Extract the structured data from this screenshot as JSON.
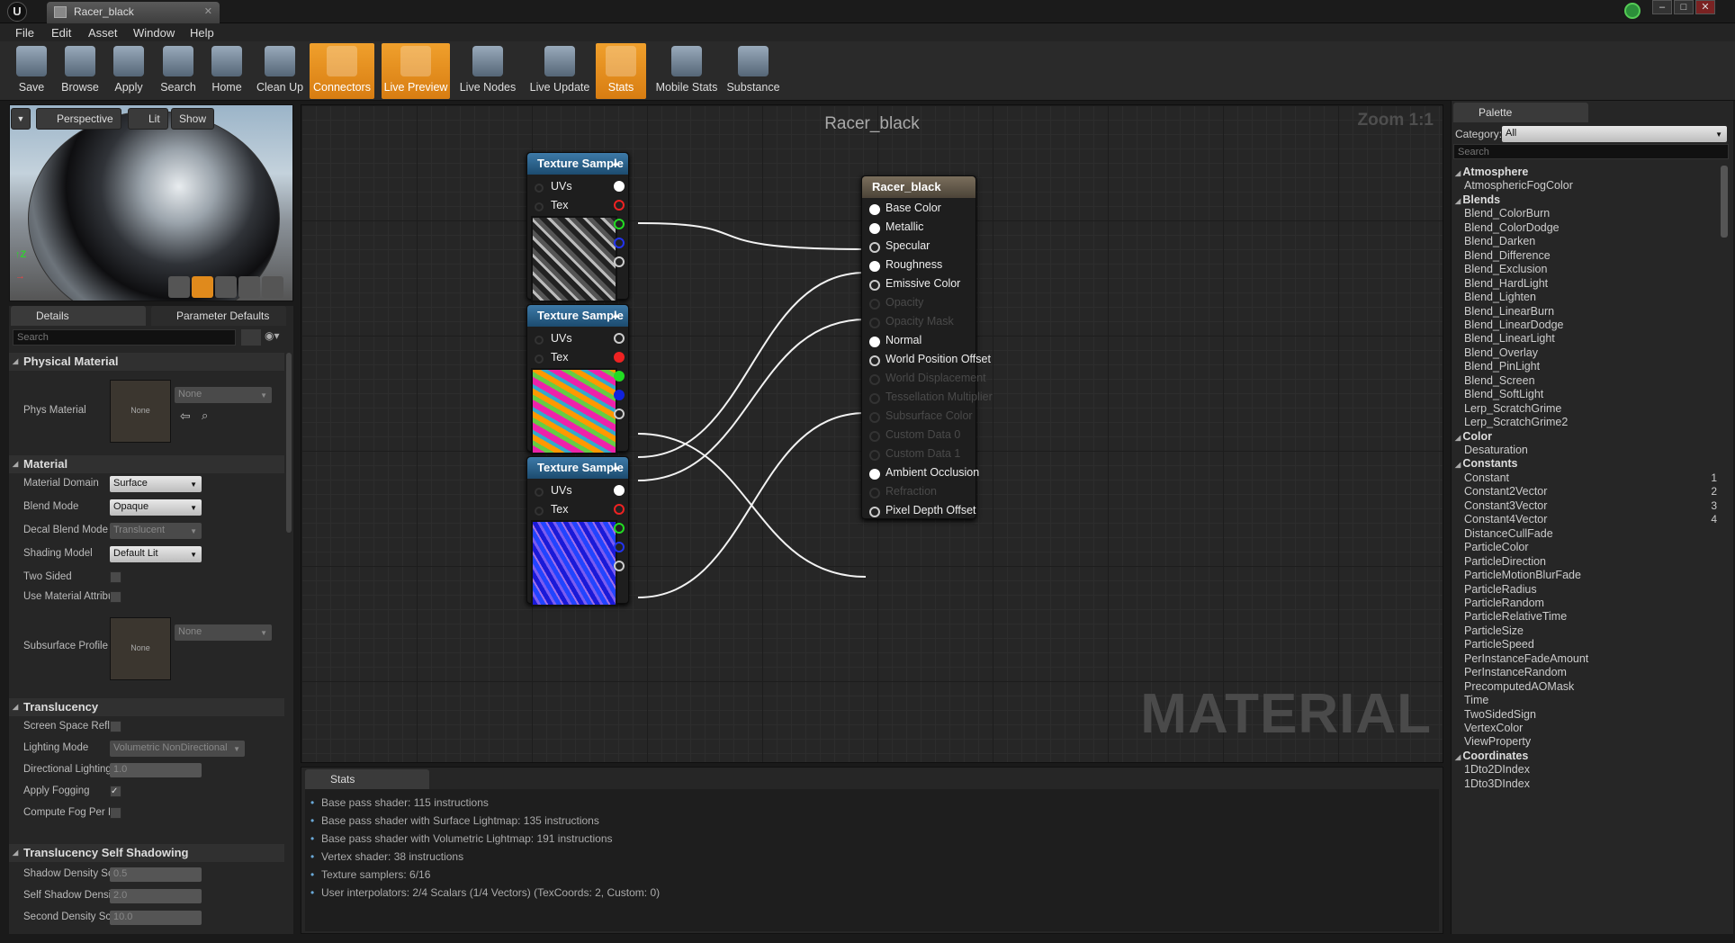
{
  "window": {
    "tab_title": "Racer_black"
  },
  "menu": [
    "File",
    "Edit",
    "Asset",
    "Window",
    "Help"
  ],
  "toolbar": [
    {
      "label": "Save",
      "icon": "save-icon",
      "active": false
    },
    {
      "label": "Browse",
      "icon": "browse-icon",
      "active": false
    },
    {
      "label": "Apply",
      "icon": "apply-icon",
      "active": false
    },
    {
      "label": "Search",
      "icon": "search-icon",
      "active": false
    },
    {
      "label": "Home",
      "icon": "home-icon",
      "active": false
    },
    {
      "label": "Clean Up",
      "icon": "clean-up-icon",
      "active": false
    },
    {
      "label": "Connectors",
      "icon": "connectors-icon",
      "active": true
    },
    {
      "label": "Live Preview",
      "icon": "live-preview-icon",
      "active": true
    },
    {
      "label": "Live Nodes",
      "icon": "live-nodes-icon",
      "active": false
    },
    {
      "label": "Live Update",
      "icon": "live-update-icon",
      "active": false
    },
    {
      "label": "Stats",
      "icon": "stats-icon",
      "active": true
    },
    {
      "label": "Mobile Stats",
      "icon": "mobile-stats-icon",
      "active": false
    },
    {
      "label": "Substance",
      "icon": "substance-icon",
      "active": false
    }
  ],
  "viewport": {
    "perspective": "Perspective",
    "lit": "Lit",
    "show": "Show"
  },
  "details": {
    "tab_details": "Details",
    "tab_params": "Parameter Defaults",
    "search_placeholder": "Search",
    "physical_material": {
      "title": "Physical Material",
      "phys_label": "Phys Material",
      "thumb": "None",
      "combo": "None"
    },
    "material": {
      "title": "Material",
      "rows": [
        {
          "label": "Material Domain",
          "value": "Surface"
        },
        {
          "label": "Blend Mode",
          "value": "Opaque"
        },
        {
          "label": "Decal Blend Mode",
          "value": "Translucent"
        },
        {
          "label": "Shading Model",
          "value": "Default Lit"
        },
        {
          "label": "Two Sided",
          "value": ""
        },
        {
          "label": "Use Material Attributes",
          "value": ""
        },
        {
          "label": "Subsurface Profile",
          "thumb": "None",
          "value": "None"
        }
      ]
    },
    "translucency": {
      "title": "Translucency",
      "rows": [
        {
          "label": "Screen Space Reflections",
          "value": ""
        },
        {
          "label": "Lighting Mode",
          "value": "Volumetric NonDirectional"
        },
        {
          "label": "Directional Lighting Intensity",
          "value": "1.0"
        },
        {
          "label": "Apply Fogging",
          "value": ""
        },
        {
          "label": "Compute Fog Per Pixel",
          "value": ""
        }
      ]
    },
    "self_shadow": {
      "title": "Translucency Self Shadowing",
      "rows": [
        {
          "label": "Shadow Density Scale",
          "value": "0.5"
        },
        {
          "label": "Self Shadow Density Scale",
          "value": "2.0"
        },
        {
          "label": "Second Density Scale",
          "value": "10.0"
        }
      ]
    }
  },
  "graph": {
    "title": "Racer_black",
    "zoom": "Zoom 1:1",
    "watermark": "MATERIAL",
    "sample_nodes": [
      {
        "title": "Texture Sample",
        "uvs": "UVs",
        "tex": "Tex"
      },
      {
        "title": "Texture Sample",
        "uvs": "UVs",
        "tex": "Tex"
      },
      {
        "title": "Texture Sample",
        "uvs": "UVs",
        "tex": "Tex"
      }
    ],
    "result_node": {
      "title": "Racer_black",
      "pins": [
        {
          "label": "Base Color",
          "state": "on"
        },
        {
          "label": "Metallic",
          "state": "on"
        },
        {
          "label": "Specular",
          "state": "open"
        },
        {
          "label": "Roughness",
          "state": "on"
        },
        {
          "label": "Emissive Color",
          "state": "open"
        },
        {
          "label": "Opacity",
          "state": "dim"
        },
        {
          "label": "Opacity Mask",
          "state": "dim"
        },
        {
          "label": "Normal",
          "state": "on"
        },
        {
          "label": "World Position Offset",
          "state": "open"
        },
        {
          "label": "World Displacement",
          "state": "dim"
        },
        {
          "label": "Tessellation Multiplier",
          "state": "dim"
        },
        {
          "label": "Subsurface Color",
          "state": "dim"
        },
        {
          "label": "Custom Data 0",
          "state": "dim"
        },
        {
          "label": "Custom Data 1",
          "state": "dim"
        },
        {
          "label": "Ambient Occlusion",
          "state": "on"
        },
        {
          "label": "Refraction",
          "state": "dim"
        },
        {
          "label": "Pixel Depth Offset",
          "state": "open"
        }
      ]
    }
  },
  "stats": {
    "tab": "Stats",
    "lines": [
      "Base pass shader: 115 instructions",
      "Base pass shader with Surface Lightmap: 135 instructions",
      "Base pass shader with Volumetric Lightmap: 191 instructions",
      "Vertex shader: 38 instructions",
      "Texture samplers: 6/16",
      "User interpolators: 2/4 Scalars (1/4 Vectors) (TexCoords: 2, Custom: 0)"
    ]
  },
  "palette": {
    "tab": "Palette",
    "category_label": "Category:",
    "category_value": "All",
    "search_placeholder": "Search",
    "entries": [
      {
        "type": "cat",
        "text": "Atmosphere"
      },
      {
        "type": "item",
        "text": "AtmosphericFogColor"
      },
      {
        "type": "cat",
        "text": "Blends"
      },
      {
        "type": "item",
        "text": "Blend_ColorBurn"
      },
      {
        "type": "item",
        "text": "Blend_ColorDodge"
      },
      {
        "type": "item",
        "text": "Blend_Darken"
      },
      {
        "type": "item",
        "text": "Blend_Difference"
      },
      {
        "type": "item",
        "text": "Blend_Exclusion"
      },
      {
        "type": "item",
        "text": "Blend_HardLight"
      },
      {
        "type": "item",
        "text": "Blend_Lighten"
      },
      {
        "type": "item",
        "text": "Blend_LinearBurn"
      },
      {
        "type": "item",
        "text": "Blend_LinearDodge"
      },
      {
        "type": "item",
        "text": "Blend_LinearLight"
      },
      {
        "type": "item",
        "text": "Blend_Overlay"
      },
      {
        "type": "item",
        "text": "Blend_PinLight"
      },
      {
        "type": "item",
        "text": "Blend_Screen"
      },
      {
        "type": "item",
        "text": "Blend_SoftLight"
      },
      {
        "type": "item",
        "text": "Lerp_ScratchGrime"
      },
      {
        "type": "item",
        "text": "Lerp_ScratchGrime2"
      },
      {
        "type": "cat",
        "text": "Color"
      },
      {
        "type": "item",
        "text": "Desaturation"
      },
      {
        "type": "cat",
        "text": "Constants"
      },
      {
        "type": "item",
        "text": "Constant",
        "hot": "1"
      },
      {
        "type": "item",
        "text": "Constant2Vector",
        "hot": "2"
      },
      {
        "type": "item",
        "text": "Constant3Vector",
        "hot": "3"
      },
      {
        "type": "item",
        "text": "Constant4Vector",
        "hot": "4"
      },
      {
        "type": "item",
        "text": "DistanceCullFade"
      },
      {
        "type": "item",
        "text": "ParticleColor"
      },
      {
        "type": "item",
        "text": "ParticleDirection"
      },
      {
        "type": "item",
        "text": "ParticleMotionBlurFade"
      },
      {
        "type": "item",
        "text": "ParticleRadius"
      },
      {
        "type": "item",
        "text": "ParticleRandom"
      },
      {
        "type": "item",
        "text": "ParticleRelativeTime"
      },
      {
        "type": "item",
        "text": "ParticleSize"
      },
      {
        "type": "item",
        "text": "ParticleSpeed"
      },
      {
        "type": "item",
        "text": "PerInstanceFadeAmount"
      },
      {
        "type": "item",
        "text": "PerInstanceRandom"
      },
      {
        "type": "item",
        "text": "PrecomputedAOMask"
      },
      {
        "type": "item",
        "text": "Time"
      },
      {
        "type": "item",
        "text": "TwoSidedSign"
      },
      {
        "type": "item",
        "text": "VertexColor"
      },
      {
        "type": "item",
        "text": "ViewProperty"
      },
      {
        "type": "cat",
        "text": "Coordinates"
      },
      {
        "type": "item",
        "text": "1Dto2DIndex"
      },
      {
        "type": "item",
        "text": "1Dto3DIndex"
      }
    ]
  },
  "colors": {
    "accent": "#e88f1c",
    "node_header": "#2a6494",
    "wire": "#ffffff"
  }
}
